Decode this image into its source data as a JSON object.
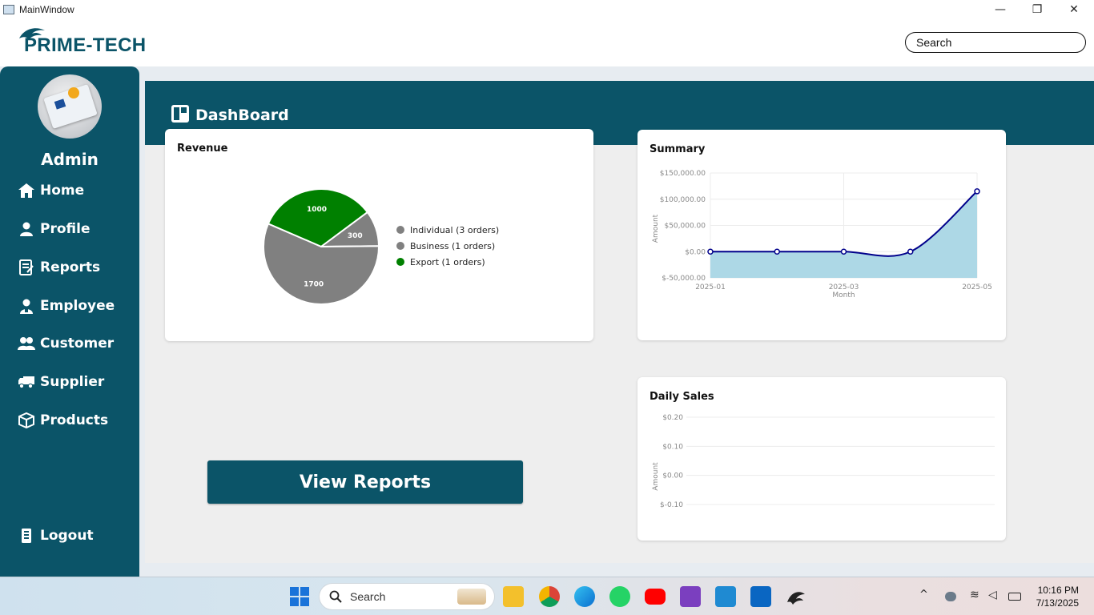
{
  "window": {
    "title": "MainWindow",
    "minimize": "—",
    "maximize": "❐",
    "close": "✕"
  },
  "header": {
    "brand": "PRIME-TECH",
    "search_placeholder": "Search"
  },
  "sidebar": {
    "user": "Admin",
    "items": [
      {
        "label": "Home",
        "icon": "home-icon"
      },
      {
        "label": "Profile",
        "icon": "user-icon"
      },
      {
        "label": "Reports",
        "icon": "report-icon"
      },
      {
        "label": "Employee",
        "icon": "employee-icon"
      },
      {
        "label": "Customer",
        "icon": "customers-icon"
      },
      {
        "label": "Supplier",
        "icon": "truck-icon"
      },
      {
        "label": "Products",
        "icon": "box-icon"
      }
    ],
    "logout": "Logout"
  },
  "dashboard": {
    "title": "DashBoard",
    "view_reports": "View Reports"
  },
  "colors": {
    "brand": "#0b5468",
    "pie_grey": "#808080",
    "pie_green": "#008000",
    "line": "#00008b",
    "area": "#add8e6"
  },
  "chart_data": [
    {
      "type": "pie",
      "title": "Revenue",
      "categories": [
        "Export",
        "Business",
        "Individual"
      ],
      "values": [
        1000,
        300,
        1700
      ],
      "legend": [
        "Individual (3 orders)",
        "Business (1 orders)",
        "Export (1 orders)"
      ],
      "legend_position": "right"
    },
    {
      "type": "area",
      "title": "Summary",
      "xlabel": "Month",
      "ylabel": "Amount",
      "x_ticks": [
        "2025-01",
        "2025-03",
        "2025-05"
      ],
      "y_ticks": [
        "$150,000.00",
        "$100,000.00",
        "$50,000.00",
        "$0.00",
        "$-50,000.00"
      ],
      "x": [
        "2025-01",
        "2025-02",
        "2025-03",
        "2025-04",
        "2025-05"
      ],
      "values": [
        0,
        0,
        0,
        0,
        115000
      ],
      "ylim": [
        -50000,
        150000
      ]
    },
    {
      "type": "line",
      "title": "Daily Sales",
      "ylabel": "Amount",
      "y_ticks": [
        "$0.20",
        "$0.10",
        "$0.00",
        "$-0.10"
      ],
      "values": [],
      "ylim": [
        -0.1,
        0.2
      ]
    }
  ],
  "taskbar": {
    "search": "Search",
    "time": "10:16 PM",
    "date": "7/13/2025"
  }
}
